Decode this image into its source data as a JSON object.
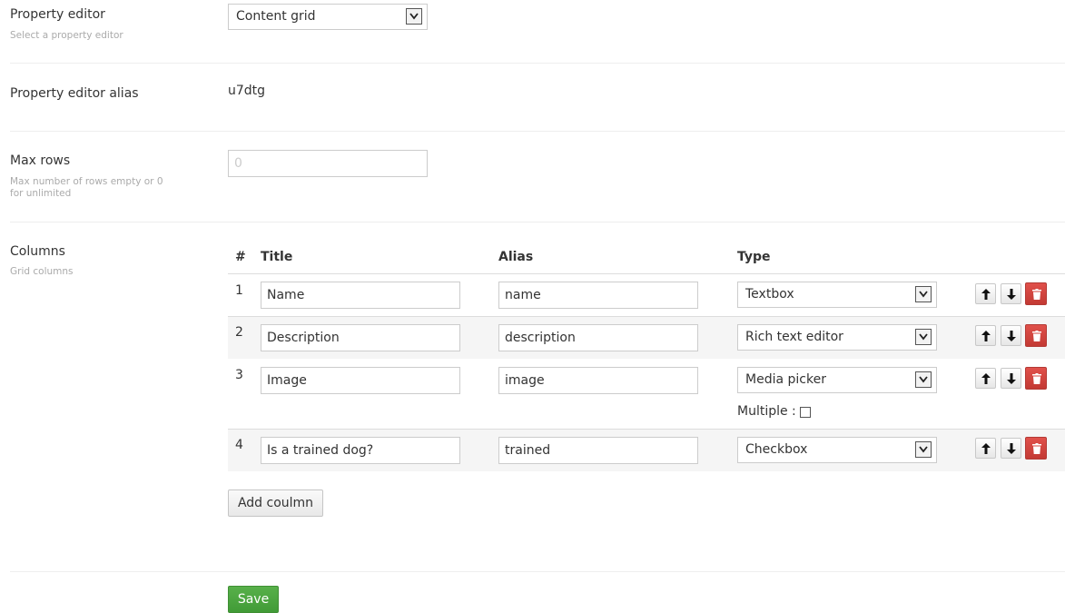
{
  "property_editor": {
    "label": "Property editor",
    "description": "Select a property editor",
    "selected": "Content grid"
  },
  "property_editor_alias": {
    "label": "Property editor alias",
    "value": "u7dtg"
  },
  "max_rows": {
    "label": "Max rows",
    "description": "Max number of rows empty or 0 for unlimited",
    "placeholder": "0"
  },
  "columns": {
    "label": "Columns",
    "description": "Grid columns",
    "headers": {
      "num": "#",
      "title": "Title",
      "alias": "Alias",
      "type": "Type"
    },
    "rows": [
      {
        "num": "1",
        "title": "Name",
        "alias": "name",
        "type": "Textbox"
      },
      {
        "num": "2",
        "title": "Description",
        "alias": "description",
        "type": "Rich text editor"
      },
      {
        "num": "3",
        "title": "Image",
        "alias": "image",
        "type": "Media picker",
        "extra_label": "Multiple :",
        "extra_checked": false
      },
      {
        "num": "4",
        "title": "Is a trained dog?",
        "alias": "trained",
        "type": "Checkbox"
      }
    ],
    "add_button": "Add coulmn"
  },
  "save_button": "Save",
  "icons": {
    "up": "arrow-up-icon",
    "down": "arrow-down-icon",
    "delete": "trash-icon",
    "dropdown": "chevron-down-icon"
  },
  "colors": {
    "danger": "#c9423c",
    "success": "#4aa63e"
  }
}
